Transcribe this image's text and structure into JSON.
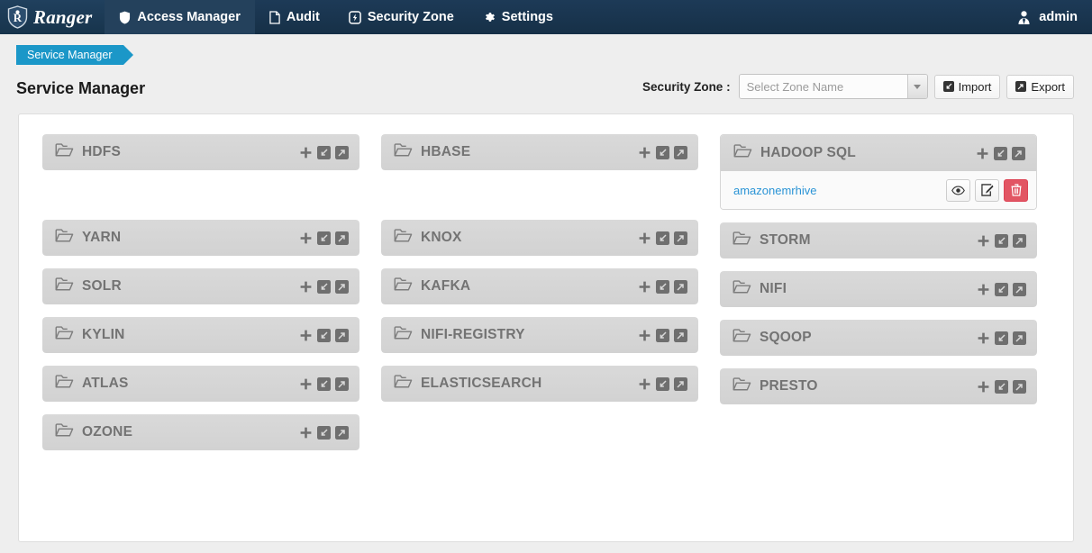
{
  "nav": {
    "brand": "Ranger",
    "items": [
      {
        "label": "Access Manager",
        "icon": "shield-icon",
        "active": true
      },
      {
        "label": "Audit",
        "icon": "file-icon",
        "active": false
      },
      {
        "label": "Security Zone",
        "icon": "bolt-icon",
        "active": false
      },
      {
        "label": "Settings",
        "icon": "gear-icon",
        "active": false
      }
    ],
    "user": {
      "label": "admin",
      "icon": "user-icon"
    }
  },
  "breadcrumb": {
    "label": "Service Manager"
  },
  "page": {
    "title": "Service Manager"
  },
  "toolbar": {
    "zone_label": "Security Zone :",
    "zone_placeholder": "Select Zone Name",
    "zone_value": "",
    "import_label": "Import",
    "export_label": "Export"
  },
  "colors": {
    "navbar": "#1d3a57",
    "navbar_active": "#24415c",
    "breadcrumb": "#1b97c8",
    "panel_header": "#d6d6d6",
    "panel_title_text": "#737373",
    "link": "#2a94d6",
    "danger": "#e25563"
  },
  "panel_action_icons": {
    "add": "plus-icon",
    "import": "import-square-icon",
    "export": "export-square-icon"
  },
  "row_action_icons": {
    "view": "eye-icon",
    "edit": "pencil-square-icon",
    "delete": "trash-icon"
  },
  "columns": [
    {
      "panels": [
        {
          "name": "HDFS",
          "services": []
        },
        {
          "name": "YARN",
          "services": []
        },
        {
          "name": "SOLR",
          "services": []
        },
        {
          "name": "KYLIN",
          "services": []
        },
        {
          "name": "ATLAS",
          "services": []
        },
        {
          "name": "OZONE",
          "services": []
        }
      ]
    },
    {
      "panels": [
        {
          "name": "HBASE",
          "services": []
        },
        {
          "name": "KNOX",
          "services": []
        },
        {
          "name": "KAFKA",
          "services": []
        },
        {
          "name": "NIFI-REGISTRY",
          "services": []
        },
        {
          "name": "ELASTICSEARCH",
          "services": []
        }
      ]
    },
    {
      "panels": [
        {
          "name": "HADOOP SQL",
          "services": [
            {
              "name": "amazonemrhive"
            }
          ]
        },
        {
          "name": "STORM",
          "services": []
        },
        {
          "name": "NIFI",
          "services": []
        },
        {
          "name": "SQOOP",
          "services": []
        },
        {
          "name": "PRESTO",
          "services": []
        }
      ]
    }
  ]
}
